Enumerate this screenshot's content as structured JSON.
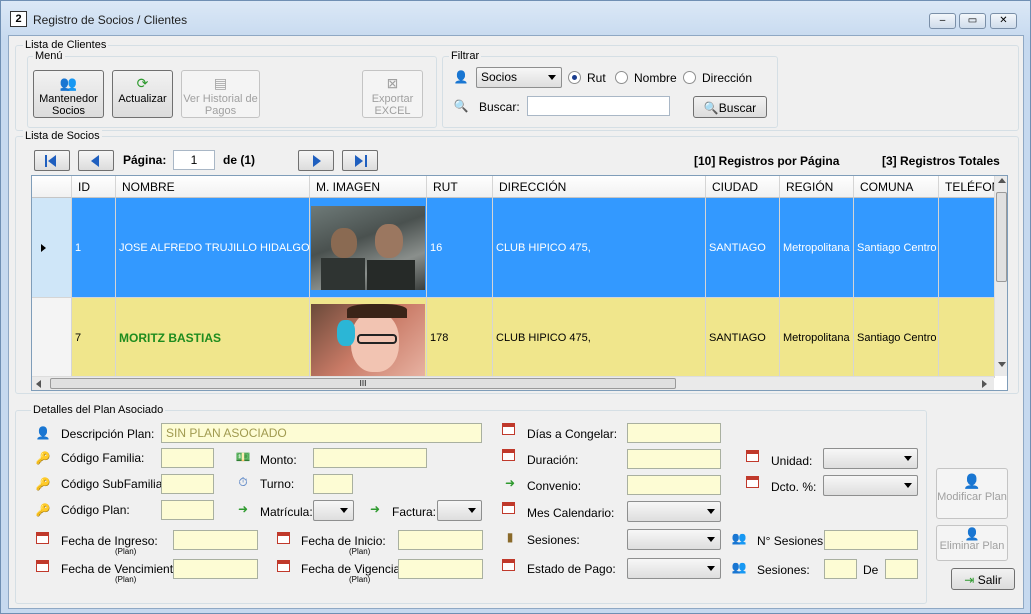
{
  "window": {
    "title": "Registro de Socios / Clientes",
    "icon_text": "2",
    "minimize": "‒",
    "maximize": "▭",
    "close": "✕"
  },
  "lista_clientes": {
    "label": "Lista de Clientes",
    "menu": {
      "label": "Menú",
      "mantenedor": "Mantenedor Socios",
      "actualizar": "Actualizar",
      "historial": "Ver Historial de Pagos",
      "exportar": "Exportar EXCEL"
    },
    "filtro": {
      "label": "Filtrar",
      "select_value": "Socios",
      "radios": [
        "Rut",
        "Nombre",
        "Dirección"
      ],
      "selected_radio": "Rut",
      "buscar_label": "Buscar:",
      "buscar_value": "",
      "buscar_button": "Buscar"
    }
  },
  "lista_socios": {
    "label": "Lista de Socios",
    "pagina_label": "Página:",
    "pagina_value": "1",
    "de_label": "de (1)",
    "registros_pagina": "[10] Registros por Página",
    "registros_totales": "[3] Registros Totales",
    "columns": [
      "ID",
      "NOMBRE",
      "M. IMAGEN",
      "RUT",
      "DIRECCIÓN",
      "CIUDAD",
      "REGIÓN",
      "COMUNA",
      "TELÉFONO"
    ],
    "rows": [
      {
        "id": "1",
        "nombre": "JOSE ALFREDO TRUJILLO HIDALGO",
        "rut": "16",
        "direccion": "CLUB HIPICO 475,",
        "ciudad": "SANTIAGO",
        "region": "Metropolitana",
        "comuna": "Santiago Centro",
        "telefono": ""
      },
      {
        "id": "7",
        "nombre": "MORITZ BASTIAS",
        "rut": "178",
        "direccion": "CLUB HIPICO 475,",
        "ciudad": "SANTIAGO",
        "region": "Metropolitana",
        "comuna": "Santiago Centro",
        "telefono": ""
      }
    ],
    "hscroll_grip": "III"
  },
  "detalles": {
    "label": "Detalles del Plan Asociado",
    "descripcion_label": "Descripción Plan:",
    "descripcion_value": "SIN PLAN ASOCIADO",
    "codigo_familia": "Código Familia:",
    "codigo_subfamilia": "Código SubFamilia:",
    "codigo_plan": "Código Plan:",
    "monto": "Monto:",
    "turno": "Turno:",
    "matricula": "Matrícula:",
    "factura": "Factura:",
    "fecha_ingreso": "Fecha de Ingreso:",
    "fecha_vencimiento": "Fecha de Vencimiento:",
    "fecha_inicio": "Fecha de Inicio:",
    "fecha_vigencia": "Fecha de Vigencia:",
    "plan_sub": "(Plan)",
    "dias_congelar": "Días a Congelar:",
    "duracion": "Duración:",
    "convenio": "Convenio:",
    "mes_calendario": "Mes Calendario:",
    "sesiones": "Sesiones:",
    "estado_pago": "Estado de Pago:",
    "unidad": "Unidad:",
    "dcto": "Dcto. %:",
    "n_sesiones": "N° Sesiones:",
    "sesiones2": "Sesiones:",
    "de": "De"
  },
  "actions": {
    "modificar": "Modificar Plan",
    "eliminar": "Eliminar Plan",
    "salir": "Salir"
  },
  "colors": {
    "selected_row": "#3399ff",
    "alt_row": "#f0e68c",
    "name_green": "#1e8c1e"
  }
}
